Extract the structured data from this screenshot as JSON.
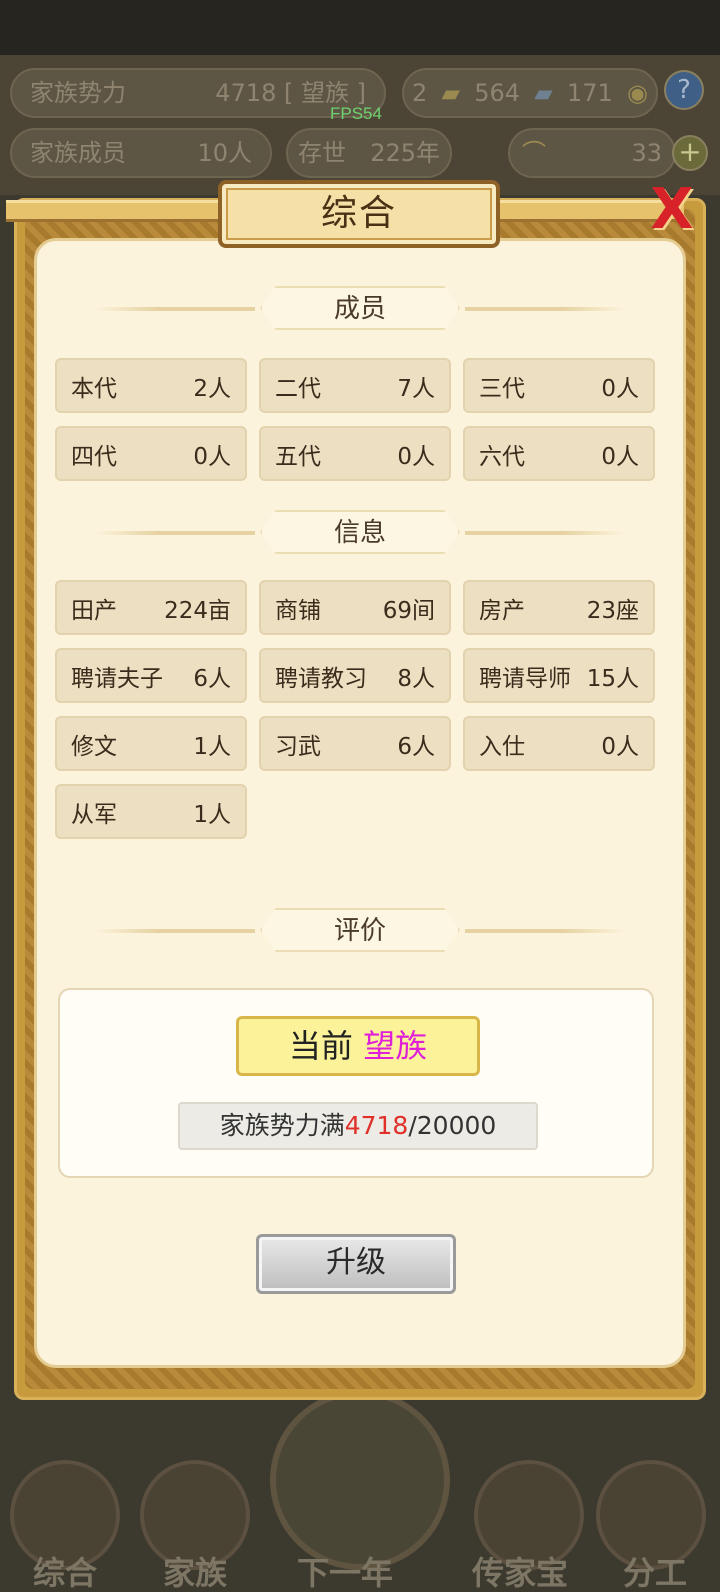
{
  "hud": {
    "power_label": "家族势力",
    "power_value": "4718 [ 望族 ]",
    "fps": "FPS54",
    "gold_count": "2",
    "silver_count": "564",
    "coin_count": "171",
    "help_label": "?",
    "members_label": "家族成员",
    "members_value": "10人",
    "years_label": "存世",
    "years_value": "225年",
    "ingot_count": "33",
    "plus_label": "+"
  },
  "dialog": {
    "title": "综合",
    "close_label": "X",
    "sections": {
      "members": "成员",
      "info": "信息",
      "evaluation": "评价"
    },
    "member_stats": [
      {
        "label": "本代",
        "value": "2人"
      },
      {
        "label": "二代",
        "value": "7人"
      },
      {
        "label": "三代",
        "value": "0人"
      },
      {
        "label": "四代",
        "value": "0人"
      },
      {
        "label": "五代",
        "value": "0人"
      },
      {
        "label": "六代",
        "value": "0人"
      }
    ],
    "info_stats": [
      {
        "label": "田产",
        "value": "224亩"
      },
      {
        "label": "商铺",
        "value": "69间"
      },
      {
        "label": "房产",
        "value": "23座"
      },
      {
        "label": "聘请夫子",
        "value": "6人"
      },
      {
        "label": "聘请教习",
        "value": "8人"
      },
      {
        "label": "聘请导师",
        "value": "15人"
      },
      {
        "label": "修文",
        "value": "1人"
      },
      {
        "label": "习武",
        "value": "6人"
      },
      {
        "label": "入仕",
        "value": "0人"
      },
      {
        "label": "从军",
        "value": "1人"
      }
    ],
    "evaluation": {
      "current_label": "当前",
      "current_rank": "望族",
      "progress_label": "家族势力满",
      "progress_current": "4718",
      "progress_max": "/20000"
    },
    "upgrade_label": "升级"
  },
  "bottom_nav": [
    {
      "label": "综合"
    },
    {
      "label": "家族"
    },
    {
      "label": "下一年"
    },
    {
      "label": "传家宝"
    },
    {
      "label": "分工"
    }
  ],
  "colors": {
    "rank_color": "#e020d8",
    "progress_color": "#e0302a",
    "close_color": "#d8222a"
  }
}
